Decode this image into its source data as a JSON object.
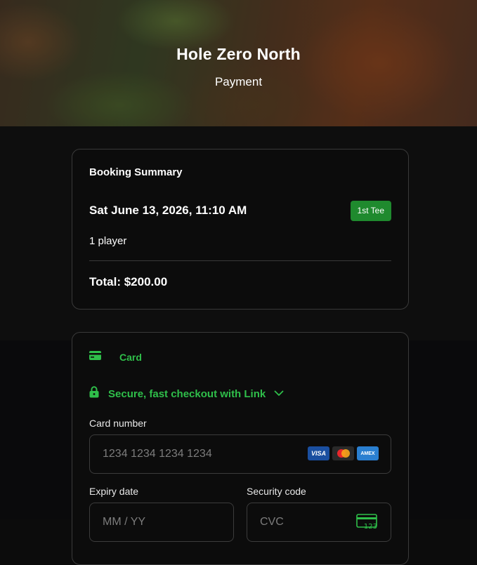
{
  "hero": {
    "title": "Hole Zero North",
    "subtitle": "Payment"
  },
  "summary": {
    "title": "Booking Summary",
    "datetime": "Sat June 13, 2026, 11:10 AM",
    "badge": "1st Tee",
    "players": "1 player",
    "total": "Total: $200.00"
  },
  "payment": {
    "tab_label": "Card",
    "link_text": "Secure, fast checkout with Link",
    "card_number": {
      "label": "Card number",
      "placeholder": "1234 1234 1234 1234"
    },
    "brands": {
      "visa": "VISA",
      "amex": "AMEX"
    },
    "expiry": {
      "label": "Expiry date",
      "placeholder": "MM / YY"
    },
    "security": {
      "label": "Security code",
      "placeholder": "CVC"
    },
    "cvc_icon_text": "123"
  },
  "colors": {
    "accent_green": "#2fbf4a",
    "badge_green": "#1f8a2e",
    "background": "#0c0c0c",
    "border": "#3a3a3a"
  }
}
